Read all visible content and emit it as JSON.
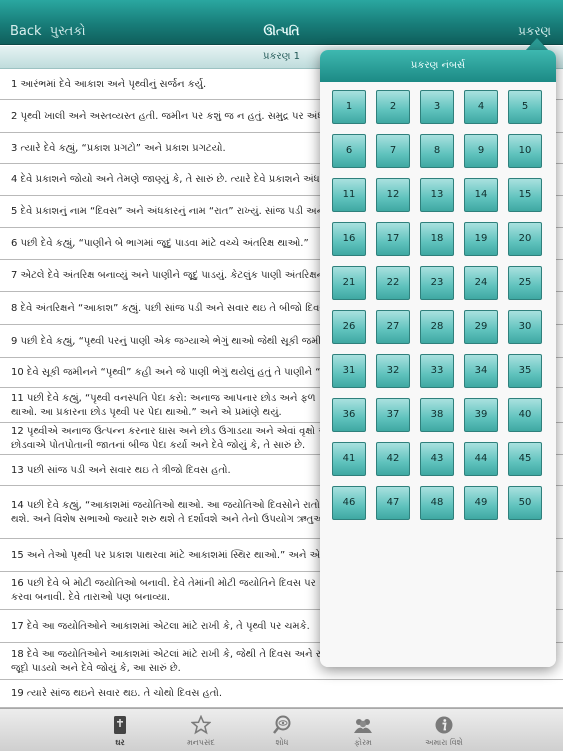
{
  "nav": {
    "back_label": "Back",
    "back_sub": "પુસ્તકો",
    "title": "ઊત્પતિ",
    "right_label": "પ્રકરણ"
  },
  "chapter_header": "પ્રકરણ 1",
  "verses": [
    "1  આરંભમાં દેવે આકાશ અને પૃથ્વીનું સર્જન કર્યુ.",
    "2  પૃથ્વી ખાલી અને અસ્તવ્યસ્ત હતી. જમીન પર કશું જ ન હતું. સમુદ્ર પર અંધકાર",
    "3  ત્યારે દેવે કહ્યું, “પ્રકાશ પ્રગટો” અને પ્રકાશ પ્રગટયો.",
    "4  દેવે પ્રકાશને જોયો અને તેમણે જાણ્યું કે, તે સારું છે. ત્યારે દેવે પ્રકાશને અંધકાર",
    "5  દેવે પ્રકાશનું નામ “દિવસ” અને અંધકારનું નામ “રાત” રાખ્યું. સાંજ પડી અને",
    "6  પછી દેવે કહ્યું, “પાણીને બે ભાગમાં જૂદું પાડવા માંટે વચ્ચે અંતરિક્ષ થાઓ.”",
    "7  એટલે દેવે અંતરિક્ષ બનાવ્યું અને પાણીને જૂદું પાડયું. કેટલુંક પાણી અંતરિક્ષની",
    "8  દેવે અંતરિક્ષને “આકાશ” કહ્યું. પછી સાંજ પડી અને સવાર થઇ તે બીજો દિવસ",
    "9  પછી દેવે કહ્યું, “પૃથ્વી પરનું પાણી એક જગ્યાએ ભેગું થાઓ જેથી સૂકી જમીન",
    "10  દેવે સૂકી જમીનને “પૃથ્વી” કહી અને જે પાણી ભેગું થયેલું હતું તે પાણીને “",
    "11  પછી દેવે કહ્યું, “પૃથ્વી વનસ્પતિ પેદા કરો: અનાજ આપનાર છોડ અને ફળ\nથાઓ. આ પ્રકારના છોડ પૃથ્વી પર પેદા થાઓ.” અને એ પ્રમાંણે થયું.",
    "12  પૃથ્વીએ અનાજ ઉત્પન્ન કરનાર ઘાસ અને છોડ ઉગાડયા અને એવાં વૃક્ષો અને\nછોડવાએ પોતપોતાની જાતનાં બીજ પેદા કર્યા અને દેવે જોયું કે, તે સારું છે.",
    "13  પછી સાંજ પડી અને સવાર થઇ તે ત્રીજો દિવસ હતો.",
    "14  પછી દેવે કહ્યું, “આકાશમાં જયોતિઓ થાઓ. આ જયોતિઓ દિવસોને રાતોથી\nથશે. અને વિશેષ સભાઓ જ્યારે શરુ થશે તે દર્શાવશે અને તેનો ઉપયોગ ઋતુઓ, [",
    "15  અને તેઓ પૃથ્વી પર પ્રકાશ પાથરવા માંટે આકાશમાં સ્થિર થાઓ.” અને એમ",
    "16  પછી દેવે બે મોટી જયોતિઓ બનાવી. દેવે તેમાંની મોટી જયોતિને દિવસ પર\nકરવા બનાવી. દેવે તારાઓ પણ બનાવ્યા.",
    "17  દેવે આ જયોતિઓને આકાશમાં એટલા માંટે રાખી કે, તે પૃથ્વી પર ચમકે.",
    "18  દેવે આ જયોતિઓને આકાશમાં એટલાં માંટે રાખી કે, જેથી તે દિવસ અને રાત\nજૂદો પાડયો અને દેવે જોયું કે, આ સારું છે.",
    "19  ત્યારે સાંજ થઇને સવાર થઇ. તે ચોથો દિવસ હતો."
  ],
  "popover": {
    "title": "પ્રકરણ નંબર્સ",
    "chapters": [
      "1",
      "2",
      "3",
      "4",
      "5",
      "6",
      "7",
      "8",
      "9",
      "10",
      "11",
      "12",
      "13",
      "14",
      "15",
      "16",
      "17",
      "18",
      "19",
      "20",
      "21",
      "22",
      "23",
      "24",
      "25",
      "26",
      "27",
      "28",
      "29",
      "30",
      "31",
      "32",
      "33",
      "34",
      "35",
      "36",
      "37",
      "38",
      "39",
      "40",
      "41",
      "42",
      "43",
      "44",
      "45",
      "46",
      "47",
      "48",
      "49",
      "50"
    ]
  },
  "tabs": [
    {
      "label": "ઘર",
      "icon": "bible-icon",
      "active": true
    },
    {
      "label": "મનપસંદ",
      "icon": "star-icon",
      "active": false
    },
    {
      "label": "શોધ",
      "icon": "search-eye-icon",
      "active": false
    },
    {
      "label": "ફોરમ",
      "icon": "people-icon",
      "active": false
    },
    {
      "label": "અમારા વિશે",
      "icon": "info-icon",
      "active": false
    }
  ],
  "colors": {
    "accent": "#1c8a85",
    "cell": "#5fc2bd"
  }
}
